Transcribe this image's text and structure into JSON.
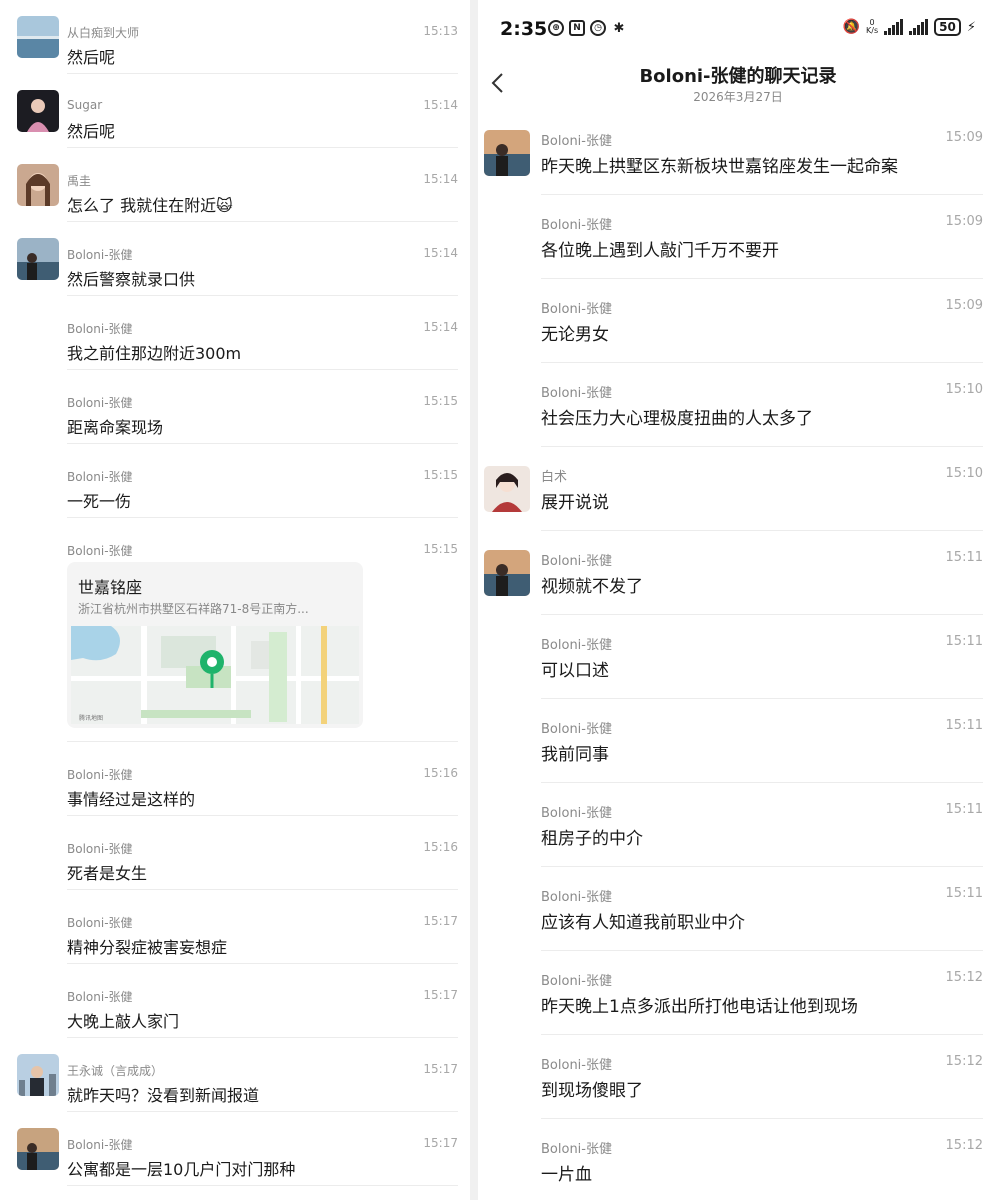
{
  "colors": {
    "pin": "#1fb36b",
    "divider": "#ececec",
    "card_bg": "#f4f4f4"
  },
  "left": {
    "messages": [
      {
        "sender": "从白痴到大师",
        "time": "15:13",
        "text": "然后呢",
        "avatar": "sea-avatar"
      },
      {
        "sender": "Sugar",
        "time": "15:14",
        "text": "然后呢",
        "avatar": "girl-avatar"
      },
      {
        "sender": "禹圭",
        "time": "15:14",
        "text": "怎么了 我就住在附近🙀",
        "avatar": "woman-avatar"
      },
      {
        "sender": "Boloni-张健",
        "time": "15:14",
        "text": "然后警察就录口供",
        "avatar": "man-sea-avatar"
      },
      {
        "sender": "Boloni-张健",
        "time": "15:14",
        "text": "我之前住那边附近300m"
      },
      {
        "sender": "Boloni-张健",
        "time": "15:15",
        "text": "距离命案现场"
      },
      {
        "sender": "Boloni-张健",
        "time": "15:15",
        "text": "一死一伤"
      },
      {
        "sender": "Boloni-张健",
        "time": "15:15",
        "location": {
          "title": "世嘉铭座",
          "address": "浙江省杭州市拱墅区石祥路71-8号正南方..."
        }
      },
      {
        "sender": "Boloni-张健",
        "time": "15:16",
        "text": "事情经过是这样的"
      },
      {
        "sender": "Boloni-张健",
        "time": "15:16",
        "text": "死者是女生"
      },
      {
        "sender": "Boloni-张健",
        "time": "15:17",
        "text": "精神分裂症被害妄想症"
      },
      {
        "sender": "Boloni-张健",
        "time": "15:17",
        "text": "大晚上敲人家门"
      },
      {
        "sender": "王永诚（言成成）",
        "time": "15:17",
        "text": "就昨天吗？没看到新闻报道",
        "avatar": "city-avatar"
      },
      {
        "sender": "Boloni-张健",
        "time": "15:17",
        "text": "公寓都是一层10几户门对门那种",
        "avatar": "man-sea-avatar"
      }
    ]
  },
  "right": {
    "status": {
      "clock": "2:35",
      "net_speed_top": "0",
      "net_speed_bottom": "K/s",
      "battery": "50"
    },
    "header": {
      "title": "Boloni-张健的聊天记录",
      "date": "2026年3月27日"
    },
    "messages": [
      {
        "sender": "Boloni-张健",
        "time": "15:09",
        "text": "昨天晚上拱墅区东新板块世嘉铭座发生一起命案",
        "avatar": "man-sea-avatar"
      },
      {
        "sender": "Boloni-张健",
        "time": "15:09",
        "text": "各位晚上遇到人敲门千万不要开"
      },
      {
        "sender": "Boloni-张健",
        "time": "15:09",
        "text": "无论男女"
      },
      {
        "sender": "Boloni-张健",
        "time": "15:10",
        "text": "社会压力大心理极度扭曲的人太多了"
      },
      {
        "sender": "白术",
        "time": "15:10",
        "text": "展开说说",
        "avatar": "anime-avatar"
      },
      {
        "sender": "Boloni-张健",
        "time": "15:11",
        "text": "视频就不发了",
        "avatar": "man-sea-avatar"
      },
      {
        "sender": "Boloni-张健",
        "time": "15:11",
        "text": "可以口述"
      },
      {
        "sender": "Boloni-张健",
        "time": "15:11",
        "text": "我前同事"
      },
      {
        "sender": "Boloni-张健",
        "time": "15:11",
        "text": "租房子的中介"
      },
      {
        "sender": "Boloni-张健",
        "time": "15:11",
        "text": "应该有人知道我前职业中介"
      },
      {
        "sender": "Boloni-张健",
        "time": "15:12",
        "text": "昨天晚上1点多派出所打他电话让他到现场"
      },
      {
        "sender": "Boloni-张健",
        "time": "15:12",
        "text": "到现场傻眼了"
      },
      {
        "sender": "Boloni-张健",
        "time": "15:12",
        "text": "一片血"
      }
    ]
  }
}
